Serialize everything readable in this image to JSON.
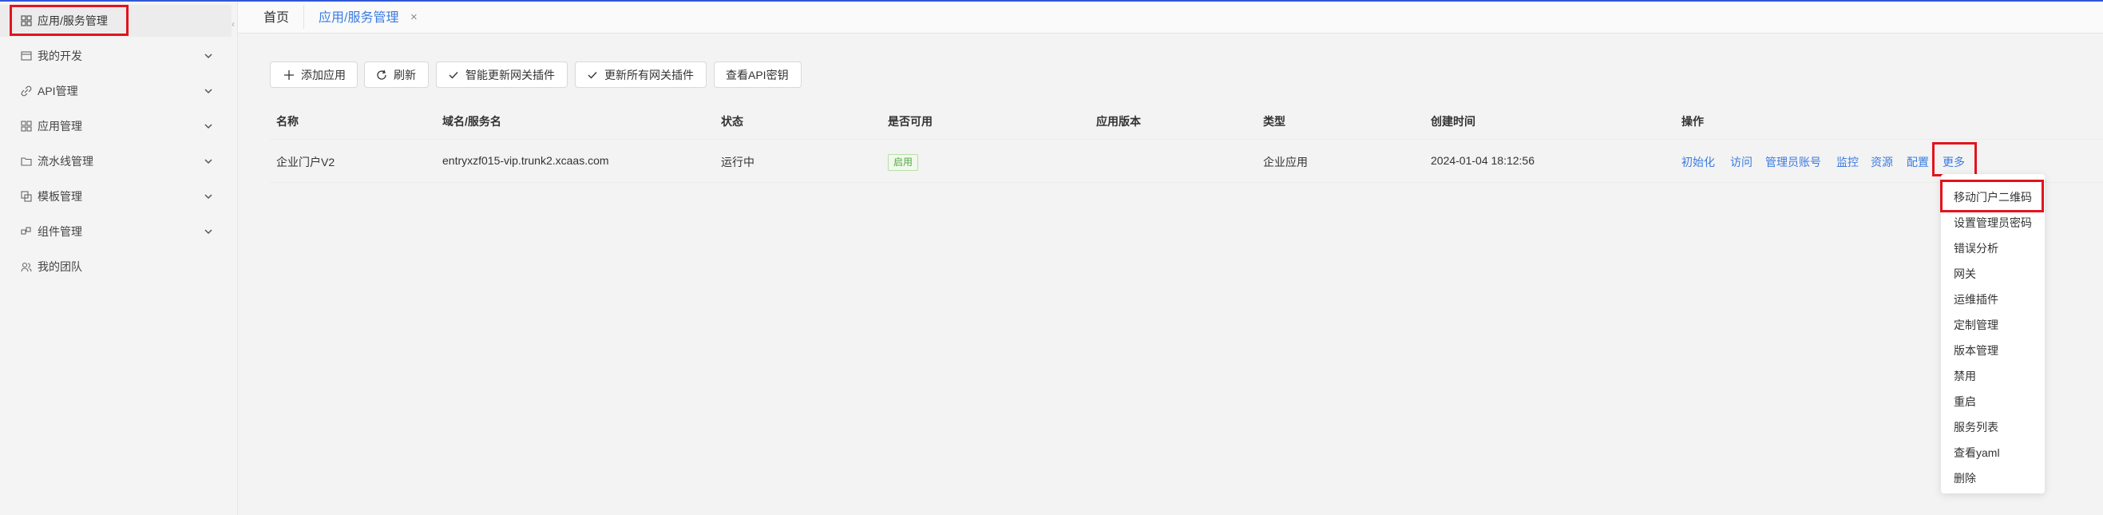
{
  "colors": {
    "accent": "#3b7be0",
    "highlight": "#e2141e",
    "topline": "#3157d6",
    "tag_green": "#52a845"
  },
  "sidebar": {
    "items": [
      {
        "label": "应用/服务管理",
        "icon": "app-grid-icon",
        "expandable": false,
        "active": true
      },
      {
        "label": "我的开发",
        "icon": "code-window-icon",
        "expandable": true
      },
      {
        "label": "API管理",
        "icon": "link-icon",
        "expandable": true
      },
      {
        "label": "应用管理",
        "icon": "grid-icon",
        "expandable": true
      },
      {
        "label": "流水线管理",
        "icon": "folder-icon",
        "expandable": true
      },
      {
        "label": "模板管理",
        "icon": "template-icon",
        "expandable": true
      },
      {
        "label": "组件管理",
        "icon": "component-icon",
        "expandable": true
      },
      {
        "label": "我的团队",
        "icon": "team-icon",
        "expandable": false
      }
    ]
  },
  "tabs": {
    "home": "首页",
    "active": "应用/服务管理",
    "close_glyph": "×"
  },
  "toolbar": {
    "add": "添加应用",
    "refresh": "刷新",
    "smart_update": "智能更新网关插件",
    "update_all": "更新所有网关插件",
    "view_secret": "查看API密钥"
  },
  "table": {
    "headers": [
      "名称",
      "域名/服务名",
      "状态",
      "是否可用",
      "应用版本",
      "类型",
      "创建时间",
      "操作"
    ],
    "rows": [
      {
        "name": "企业门户V2",
        "domain": "entryxzf015-vip.trunk2.xcaas.com",
        "status": "运行中",
        "available": "启用",
        "version": "",
        "type": "企业应用",
        "created": "2024-01-04 18:12:56",
        "actions": [
          "初始化",
          "访问",
          "管理员账号",
          "监控",
          "资源",
          "配置",
          "更多"
        ]
      }
    ]
  },
  "more_menu": {
    "items": [
      "移动门户二维码",
      "设置管理员密码",
      "错误分析",
      "网关",
      "运维插件",
      "定制管理",
      "版本管理",
      "禁用",
      "重启",
      "服务列表",
      "查看yaml",
      "删除"
    ]
  }
}
